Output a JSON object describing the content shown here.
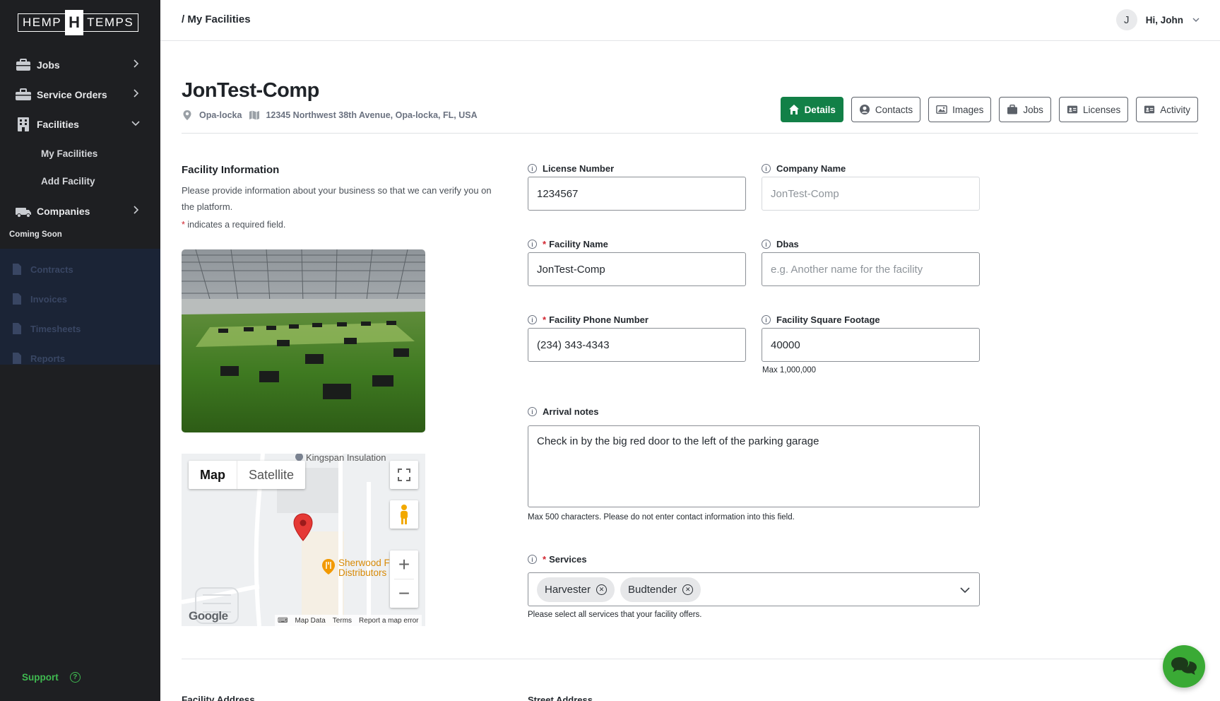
{
  "brand": {
    "left": "HEMP",
    "mark": "H",
    "right": "TEMPS"
  },
  "sidebar": {
    "items": [
      {
        "label": "Jobs"
      },
      {
        "label": "Service Orders"
      },
      {
        "label": "Facilities"
      },
      {
        "label": "Companies"
      }
    ],
    "sub_items": [
      {
        "label": "My Facilities"
      },
      {
        "label": "Add Facility"
      }
    ],
    "coming_soon": "Coming Soon",
    "disabled_items": [
      {
        "label": "Contracts"
      },
      {
        "label": "Invoices"
      },
      {
        "label": "Timesheets"
      },
      {
        "label": "Reports"
      }
    ],
    "support": "Support"
  },
  "topbar": {
    "breadcrumb": "/  My Facilities",
    "avatar_initial": "J",
    "greeting": "Hi, John"
  },
  "facility": {
    "title": "JonTest-Comp",
    "city": "Opa-locka",
    "address": "12345 Northwest 38th Avenue, Opa-locka, FL, USA"
  },
  "tabs": [
    {
      "label": "Details",
      "icon": "home-icon",
      "active": true
    },
    {
      "label": "Contacts",
      "icon": "user-circle-icon",
      "active": false
    },
    {
      "label": "Images",
      "icon": "image-icon",
      "active": false
    },
    {
      "label": "Jobs",
      "icon": "briefcase-icon",
      "active": false
    },
    {
      "label": "Licenses",
      "icon": "id-card-icon",
      "active": false
    },
    {
      "label": "Activity",
      "icon": "id-card-icon",
      "active": false
    }
  ],
  "info_section": {
    "title": "Facility Information",
    "description": "Please provide information about your business so that we can verify you on the platform.",
    "required_star": "*",
    "required_note": " indicates a required field."
  },
  "map": {
    "tab_map": "Map",
    "tab_satellite": "Satellite",
    "poi_top": "Kingspan Insulation",
    "poi_line1": "Sherwood F",
    "poi_line2": "Distributors",
    "google": "Google",
    "map_data": "Map Data",
    "terms": "Terms",
    "report": "Report a map error"
  },
  "form": {
    "license_label": "License Number",
    "license_value": "1234567",
    "company_label": "Company Name",
    "company_placeholder": "JonTest-Comp",
    "facility_name_label": "Facility Name",
    "facility_name_value": "JonTest-Comp",
    "dbas_label": "Dbas",
    "dbas_placeholder": "e.g. Another name for the facility",
    "phone_label": "Facility Phone Number",
    "phone_value": "(234) 343-4343",
    "sqft_label": "Facility Square Footage",
    "sqft_value": "40000",
    "sqft_helper": "Max 1,000,000",
    "arrival_label": "Arrival notes",
    "arrival_value": "Check in by the big red door to the left of the parking garage",
    "arrival_helper": "Max 500 characters. Please do not enter contact information into this field.",
    "services_label": "Services",
    "services": [
      "Harvester",
      "Budtender"
    ],
    "services_helper": "Please select all services that your facility offers.",
    "star": "*"
  },
  "bottom": {
    "address_title": "Facility Address",
    "street_label": "Street Address"
  },
  "colors": {
    "sidebar_bg": "#1e1f22",
    "accent_green": "#128047",
    "support_green": "#3fb950",
    "chat_green": "#3aaa35",
    "required_red": "#d1242f"
  }
}
